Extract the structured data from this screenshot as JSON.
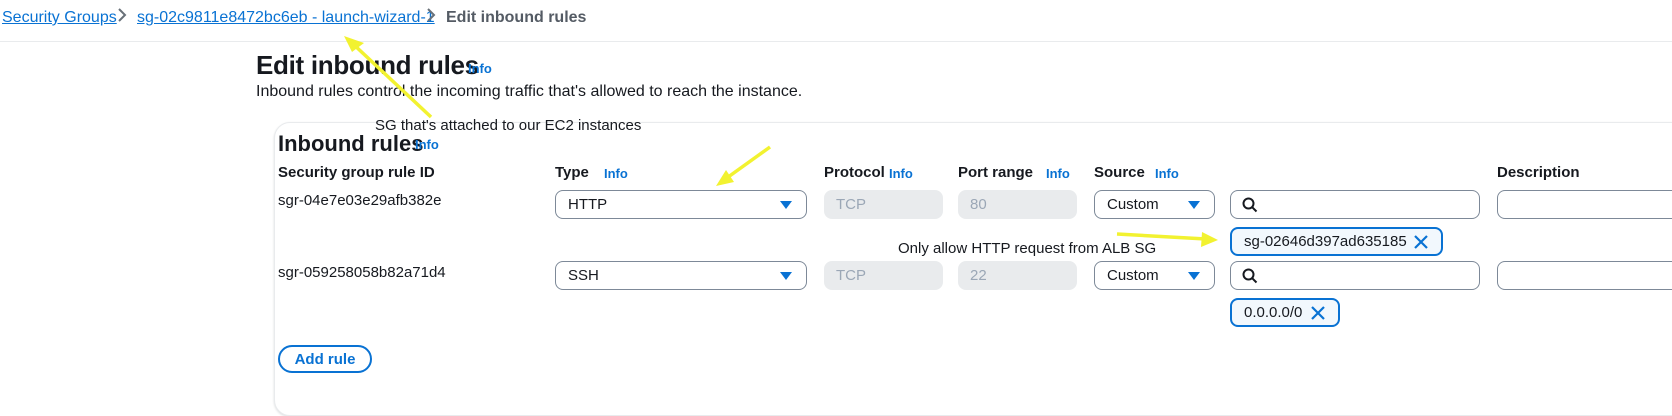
{
  "breadcrumb": {
    "items": [
      "Security Groups",
      "sg-02c9811e8472bc6eb - launch-wizard-1"
    ],
    "current": "Edit inbound rules"
  },
  "header": {
    "title": "Edit inbound rules",
    "info": "Info",
    "description": "Inbound rules control the incoming traffic that's allowed to reach the instance."
  },
  "panel": {
    "title": "Inbound rules",
    "info": "Info",
    "columns": {
      "rule_id": "Security group rule ID",
      "type": "Type",
      "protocol": "Protocol",
      "port_range": "Port range",
      "source": "Source",
      "description": "Description",
      "info": "Info"
    },
    "rules": [
      {
        "id": "sgr-04e7e03e29afb382e",
        "type": "HTTP",
        "protocol": "TCP",
        "port_range": "80",
        "source": "Custom",
        "source_token": "sg-02646d397ad635185"
      },
      {
        "id": "sgr-059258058b82a71d4",
        "type": "SSH",
        "protocol": "TCP",
        "port_range": "22",
        "source": "Custom",
        "source_token": "0.0.0.0/0"
      }
    ],
    "add_rule_label": "Add rule"
  },
  "annotations": {
    "sg_note": "SG that's attached to our EC2 instances",
    "alb_note": "Only allow HTTP request from ALB SG"
  },
  "colors": {
    "link": "#0972d3",
    "annotation_arrow": "#f2f230",
    "border": "#7d8998",
    "disabled_bg": "#e9ebed"
  },
  "icons": [
    "chevron-right-icon",
    "caret-down-icon",
    "search-icon",
    "close-icon",
    "arrow-annotation"
  ]
}
